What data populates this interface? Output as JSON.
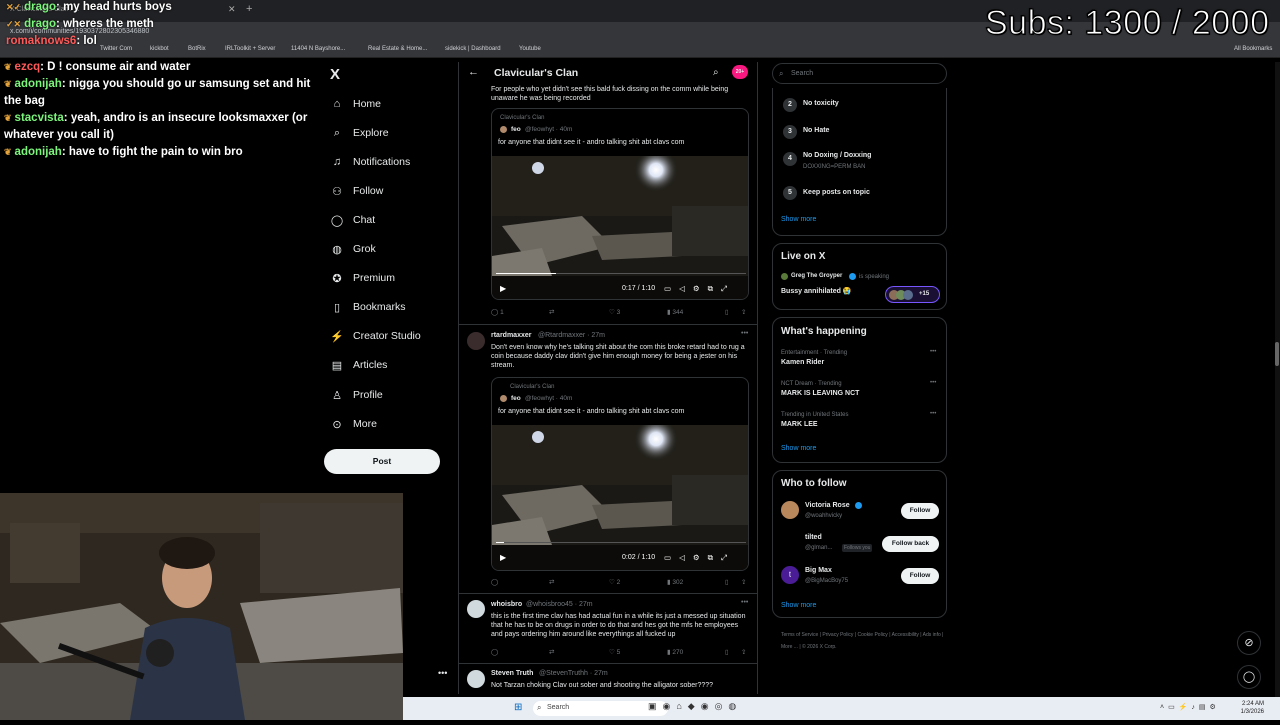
{
  "overlay": {
    "subs": "Subs: 1300 / 2000"
  },
  "browser": {
    "tab_text": "X  Clavicular's Clan / X",
    "address": "x.com/i/communities/1930372802305346880",
    "bookmarks": [
      "Twitter Com",
      "kickbot",
      "BotRix",
      "IRLToolkit + Server",
      "11404 N Bayshore...",
      "Real Estate & Home...",
      "sidekick | Dashboard",
      "Youtube",
      "All Bookmarks"
    ]
  },
  "chat": [
    {
      "user": "drago",
      "text": "my head hurts boys"
    },
    {
      "user": "drago",
      "text": "wheres the meth"
    },
    {
      "user": "romaknows6",
      "text": "lol"
    },
    {
      "user": "ezcq",
      "text": "D ! consume air and water"
    },
    {
      "user": "adonijah",
      "text": "nigga you should go ur samsung set and hit the bag"
    },
    {
      "user": "stacvista",
      "text": "yeah, andro is an insecure looksmaxxer (or whatever you call it)"
    },
    {
      "user": "adonijah",
      "text": "have to fight the pain to win bro"
    }
  ],
  "nav": {
    "logo": "X",
    "items": [
      "Home",
      "Explore",
      "Notifications",
      "Follow",
      "Chat",
      "Grok",
      "Premium",
      "Bookmarks",
      "Creator Studio",
      "Articles",
      "Profile",
      "More"
    ],
    "post": "Post"
  },
  "header": {
    "title": "Clavicular's Clan",
    "badge": "20+"
  },
  "posts": [
    {
      "text": "For people who yet didn't see this bald fuck dissing on the comm while being unaware he was being recorded",
      "quote": {
        "community": "Clavicular's Clan",
        "name": "feo",
        "handle": "@feowhyt · 40m",
        "text": "for anyone that didnt see it - andro talking shit abt clavs com"
      },
      "time": "0:17 / 1:10",
      "progress": 0.24,
      "stats": {
        "replies": "1",
        "likes": "3",
        "views": "344"
      }
    },
    {
      "name": "rtardmaxxer",
      "handle": "@Rtardmaxxer · 27m",
      "text": "Don't even know why he's talking shit about the com this broke retard had to rug a coin because daddy clav didn't give him enough money for being a jester on his stream.",
      "quote": {
        "community": "Clavicular's Clan",
        "name": "feo",
        "handle": "@feowhyt · 40m",
        "text": "for anyone that didnt see it - andro talking shit abt clavs com"
      },
      "time": "0:02 / 1:10",
      "progress": 0.03,
      "stats": {
        "likes": "2",
        "views": "302"
      }
    },
    {
      "name": "whoisbro",
      "handle": "@whoisbroo45 · 27m",
      "text": "this is the first time clav has had actual fun in a while its just a messed up situation that he has to be on drugs in order to do that and hes got the mfs he employees and pays ordering him around like everythings all fucked up",
      "stats": {
        "likes": "5",
        "views": "270"
      }
    },
    {
      "name": "Steven Truth",
      "handle": "@StevenTruthh · 27m",
      "text": "Not Tarzan choking Clav out sober and shooting the alligator sober????"
    }
  ],
  "rules": {
    "items": [
      {
        "num": "2",
        "title": "No toxicity",
        "sub": ""
      },
      {
        "num": "3",
        "title": "No Hate",
        "sub": ""
      },
      {
        "num": "4",
        "title": "No Doxing / Doxxing",
        "sub": "DOXXING=PERM BAN"
      },
      {
        "num": "5",
        "title": "Keep posts on topic",
        "sub": ""
      }
    ],
    "show_more": "Show more"
  },
  "search": {
    "placeholder": "Search"
  },
  "live": {
    "title": "Live on X",
    "host": "Greg The Groyper",
    "status": "is speaking",
    "space": "Bussy annihilated 😭",
    "count": "+15"
  },
  "happening": {
    "title": "What's happening",
    "items": [
      {
        "meta": "Entertainment · Trending",
        "title": "Kamen Rider"
      },
      {
        "meta": "NCT Dream · Trending",
        "title": "MARK IS LEAVING NCT"
      },
      {
        "meta": "Trending in United States",
        "title": "MARK LEE"
      }
    ],
    "show_more": "Show more"
  },
  "who_to_follow": {
    "title": "Who to follow",
    "items": [
      {
        "name": "Victoria Rose",
        "handle": "@woahhvicky",
        "button": "Follow",
        "tag": ""
      },
      {
        "name": "tilted",
        "handle": "@glman...",
        "button": "Follow back",
        "tag": "Follows you"
      },
      {
        "name": "Big Max",
        "handle": "@BigMacBoy75",
        "button": "Follow",
        "tag": ""
      }
    ],
    "show_more": "Show more"
  },
  "footer": {
    "links": [
      "Terms of Service",
      "Privacy Policy",
      "Cookie Policy",
      "Accessibility",
      "Ads info",
      "More ...",
      "© 2026 X Corp."
    ]
  },
  "taskbar": {
    "search": "Search",
    "time": "2:24 AM",
    "date": "1/3/2026"
  }
}
